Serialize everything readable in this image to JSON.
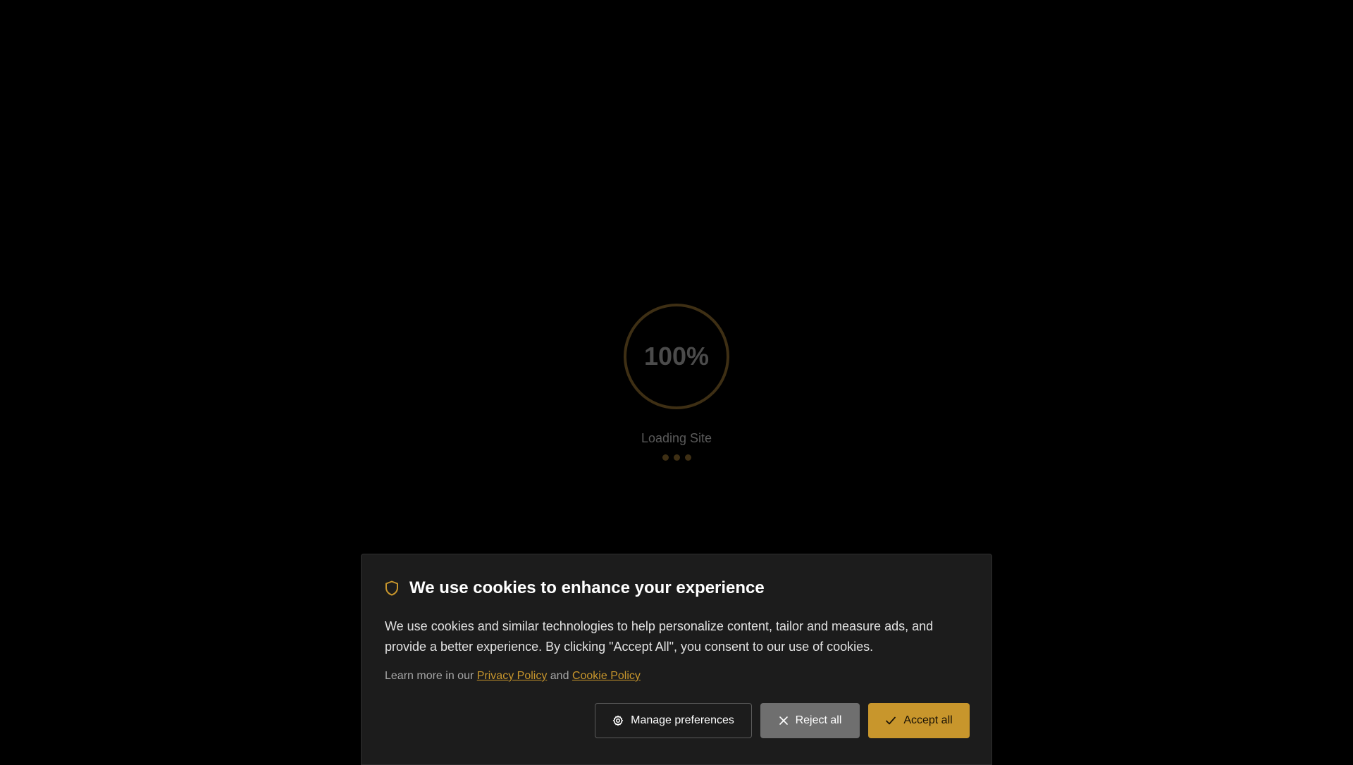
{
  "loader": {
    "progress_text": "100%",
    "progress": 100,
    "label": "Loading Site"
  },
  "cookie_banner": {
    "title": "We use cookies to enhance your experience",
    "body": "We use cookies and similar technologies to help personalize content, tailor and measure ads, and provide a better experience. By clicking \"Accept All\", you consent to our use of cookies.",
    "learn_more_prefix": "Learn more in our",
    "privacy_link": "Privacy Policy",
    "and_text": "and",
    "cookie_link": "Cookie Policy",
    "buttons": {
      "manage": "Manage preferences",
      "reject": "Reject all",
      "accept": "Accept all"
    }
  },
  "colors": {
    "background": "#000000",
    "accent": "#c8962c",
    "panel": "#1c1c1c",
    "reject_button": "#6f6f6f"
  },
  "icons": [
    "shield-icon",
    "gear-icon",
    "close-icon",
    "check-icon"
  ]
}
